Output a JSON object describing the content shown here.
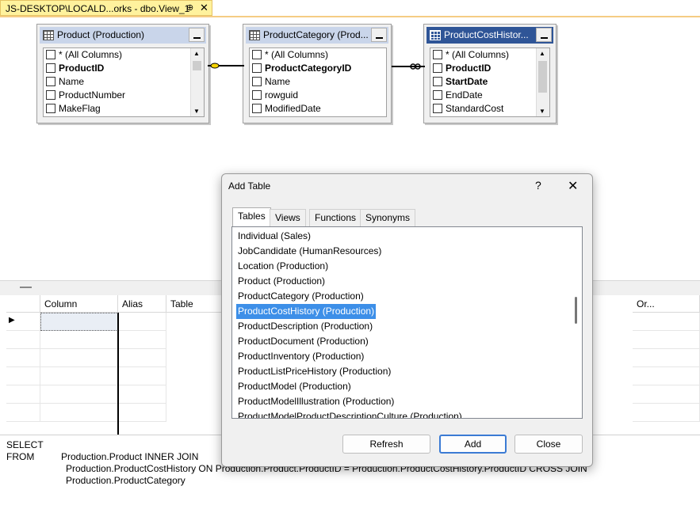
{
  "doc_tab": {
    "title": "JS-DESKTOP\\LOCALD...orks - dbo.View_1",
    "pin_glyph": "⊕",
    "close_glyph": "✕"
  },
  "diagram": {
    "tables": [
      {
        "title": "Product (Production)",
        "columns": [
          {
            "label": "* (All Columns)",
            "key": false
          },
          {
            "label": "ProductID",
            "key": true
          },
          {
            "label": "Name",
            "key": false
          },
          {
            "label": "ProductNumber",
            "key": false
          },
          {
            "label": "MakeFlag",
            "key": false
          }
        ]
      },
      {
        "title": "ProductCategory (Prod...",
        "columns": [
          {
            "label": "* (All Columns)",
            "key": false
          },
          {
            "label": "ProductCategoryID",
            "key": true
          },
          {
            "label": "Name",
            "key": false
          },
          {
            "label": "rowguid",
            "key": false
          },
          {
            "label": "ModifiedDate",
            "key": false
          }
        ]
      },
      {
        "title": "ProductCostHistor...",
        "columns": [
          {
            "label": "* (All Columns)",
            "key": false
          },
          {
            "label": "ProductID",
            "key": true
          },
          {
            "label": "StartDate",
            "key": true
          },
          {
            "label": "EndDate",
            "key": false
          },
          {
            "label": "StandardCost",
            "key": false
          }
        ]
      }
    ]
  },
  "grid": {
    "headers": [
      "Column",
      "Alias",
      "Table",
      "Or..."
    ]
  },
  "sql": {
    "line1": "SELECT",
    "kw_from": "FROM",
    "line2": "Production.Product INNER JOIN",
    "line3": "Production.ProductCostHistory ON Production.Product.ProductID = Production.ProductCostHistory.ProductID CROSS JOIN",
    "line4": "Production.ProductCategory"
  },
  "dialog": {
    "title": "Add Table",
    "help_glyph": "?",
    "close_glyph": "✕",
    "tabs": [
      "Tables",
      "Views",
      "Functions",
      "Synonyms"
    ],
    "items": [
      "Individual (Sales)",
      "JobCandidate (HumanResources)",
      "Location (Production)",
      "Product (Production)",
      "ProductCategory (Production)",
      "ProductCostHistory (Production)",
      "ProductDescription (Production)",
      "ProductDocument (Production)",
      "ProductInventory (Production)",
      "ProductListPriceHistory (Production)",
      "ProductModel (Production)",
      "ProductModelIllustration (Production)",
      "ProductModelProductDescriptionCulture (Production)"
    ],
    "selected_index": 5,
    "buttons": {
      "refresh": "Refresh",
      "add": "Add",
      "close": "Close"
    }
  },
  "colors": {
    "accent": "#3d8fe8",
    "tab_active": "#fff29d",
    "active_header": "#2f5597"
  }
}
